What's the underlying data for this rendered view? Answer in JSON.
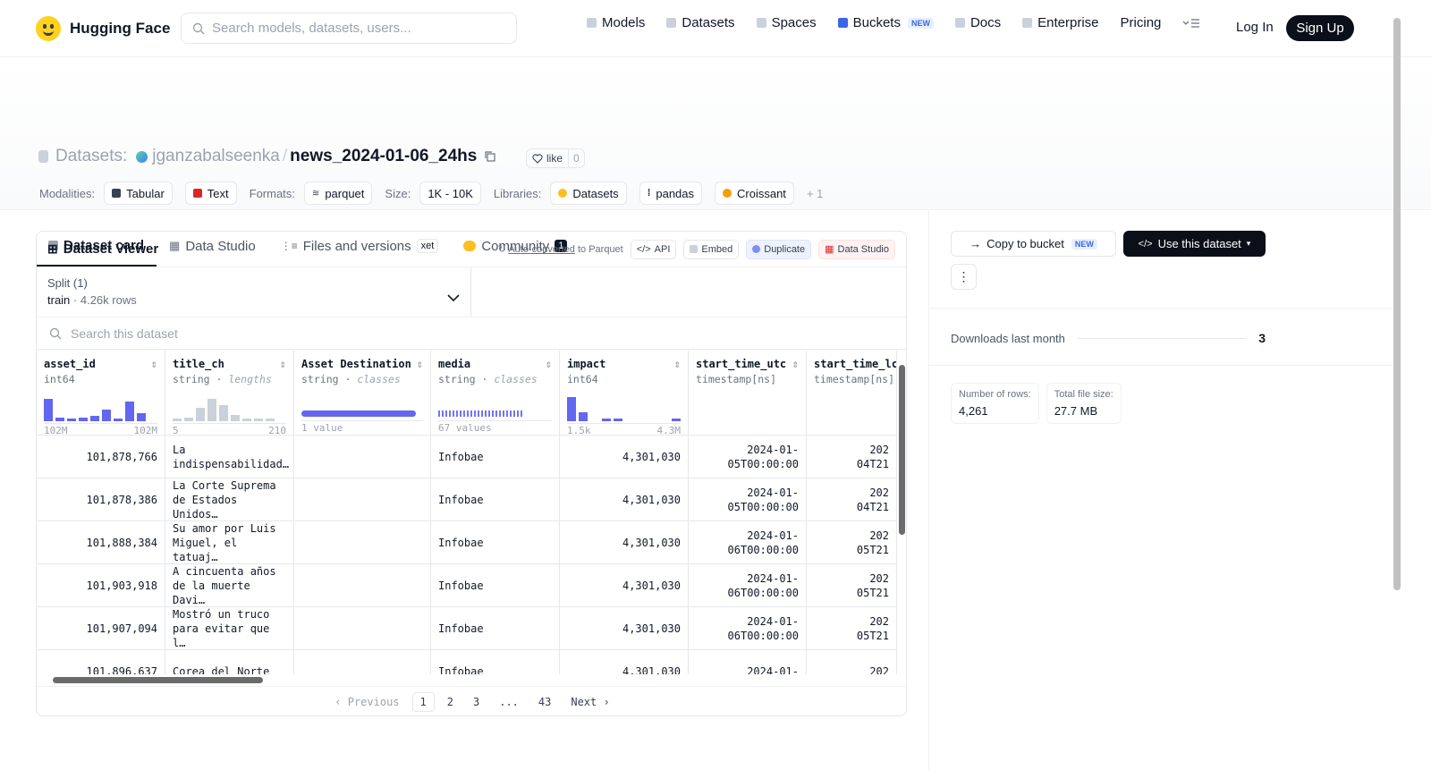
{
  "nav": {
    "brand": "Hugging Face",
    "search_placeholder": "Search models, datasets, users...",
    "links": [
      {
        "label": "Models"
      },
      {
        "label": "Datasets"
      },
      {
        "label": "Spaces"
      },
      {
        "label": "Buckets",
        "badge": "NEW"
      },
      {
        "label": "Docs"
      },
      {
        "label": "Enterprise"
      },
      {
        "label": "Pricing"
      }
    ],
    "login": "Log In",
    "signup": "Sign Up"
  },
  "repo": {
    "type_label": "Datasets:",
    "owner": "jganzabalseenka",
    "name": "news_2024-01-06_24hs",
    "like_label": "like",
    "like_count": "0"
  },
  "tags": {
    "modalities_label": "Modalities:",
    "modalities": [
      "Tabular",
      "Text"
    ],
    "formats_label": "Formats:",
    "format": "parquet",
    "size_label": "Size:",
    "size": "1K - 10K",
    "libraries_label": "Libraries:",
    "libraries": [
      "Datasets",
      "pandas",
      "Croissant"
    ],
    "more": "+ 1"
  },
  "tabs": [
    {
      "label": "Dataset card"
    },
    {
      "label": "Data Studio"
    },
    {
      "label": "Files and versions",
      "badge": "xet"
    },
    {
      "label": "Community",
      "count": "1"
    }
  ],
  "viewer": {
    "title": "Dataset Viewer",
    "auto_converted": "Auto-converted",
    "to_parquet": " to Parquet",
    "api": "API",
    "embed": "Embed",
    "duplicate": "Duplicate",
    "data_studio": "Data Studio",
    "split_label": "Split (1)",
    "split_name": "train",
    "split_rows": "4.26k rows",
    "search_placeholder": "Search this dataset",
    "columns": [
      {
        "name": "asset_id",
        "type": "int64",
        "hint": "",
        "min": "102M",
        "max": "102M",
        "hist": [
          0.85,
          0.15,
          0.1,
          0.15,
          0.2,
          0.45,
          0.1,
          0.75,
          0.3
        ]
      },
      {
        "name": "title_ch",
        "type": "string",
        "hint": "lengths",
        "min": "5",
        "max": "210",
        "hist": [
          0.05,
          0.15,
          0.5,
          0.85,
          0.6,
          0.25,
          0.05,
          0.05,
          0.05
        ]
      },
      {
        "name": "Asset Destination",
        "type": "string",
        "hint": "classes",
        "min": "1 value",
        "max": "",
        "hist": []
      },
      {
        "name": "media",
        "type": "string",
        "hint": "classes",
        "min": "67 values",
        "max": "",
        "hist": []
      },
      {
        "name": "impact",
        "type": "int64",
        "hint": "",
        "min": "1.5k",
        "max": "4.3M",
        "hist": [
          0.9,
          0.35,
          0.0,
          0.08,
          0.08,
          0.0,
          0.0,
          0.0,
          0.0,
          0.08
        ]
      },
      {
        "name": "start_time_utc",
        "type": "timestamp[ns]",
        "hint": "",
        "min": "",
        "max": "",
        "hist": []
      },
      {
        "name": "start_time_lc",
        "type": "timestamp[ns]",
        "hint": "",
        "min": "",
        "max": "",
        "hist": []
      }
    ],
    "rows": [
      [
        "101,878,766",
        "La indispensabilidad…",
        "",
        "Infobae",
        "4,301,030",
        "2024-01-05T00:00:00",
        "202",
        "04T21"
      ],
      [
        "101,878,386",
        "La Corte Suprema de Estados Unidos…",
        "",
        "Infobae",
        "4,301,030",
        "2024-01-05T00:00:00",
        "202",
        "04T21"
      ],
      [
        "101,888,384",
        "Su amor por Luis Miguel, el tatuaj…",
        "",
        "Infobae",
        "4,301,030",
        "2024-01-06T00:00:00",
        "202",
        "05T21"
      ],
      [
        "101,903,918",
        "A cincuenta años de la muerte Davi…",
        "",
        "Infobae",
        "4,301,030",
        "2024-01-06T00:00:00",
        "202",
        "05T21"
      ],
      [
        "101,907,094",
        "Mostró un truco para evitar que l…",
        "",
        "Infobae",
        "4,301,030",
        "2024-01-06T00:00:00",
        "202",
        "05T21"
      ],
      [
        "101,896,637",
        "Corea del Norte",
        "",
        "Infobae",
        "4,301,030",
        "2024-01-",
        "202",
        ""
      ]
    ],
    "pager": {
      "prev": "Previous",
      "pages": [
        "1",
        "2",
        "3",
        "...",
        "43"
      ],
      "next": "Next"
    }
  },
  "sidebar": {
    "copy_bucket": "Copy to bucket",
    "copy_badge": "NEW",
    "use_dataset": "Use this dataset",
    "downloads_label": "Downloads last month",
    "downloads_value": "3",
    "rows_label": "Number of rows:",
    "rows_value": "4,261",
    "size_label": "Total file size:",
    "size_value": "27.7 MB"
  }
}
